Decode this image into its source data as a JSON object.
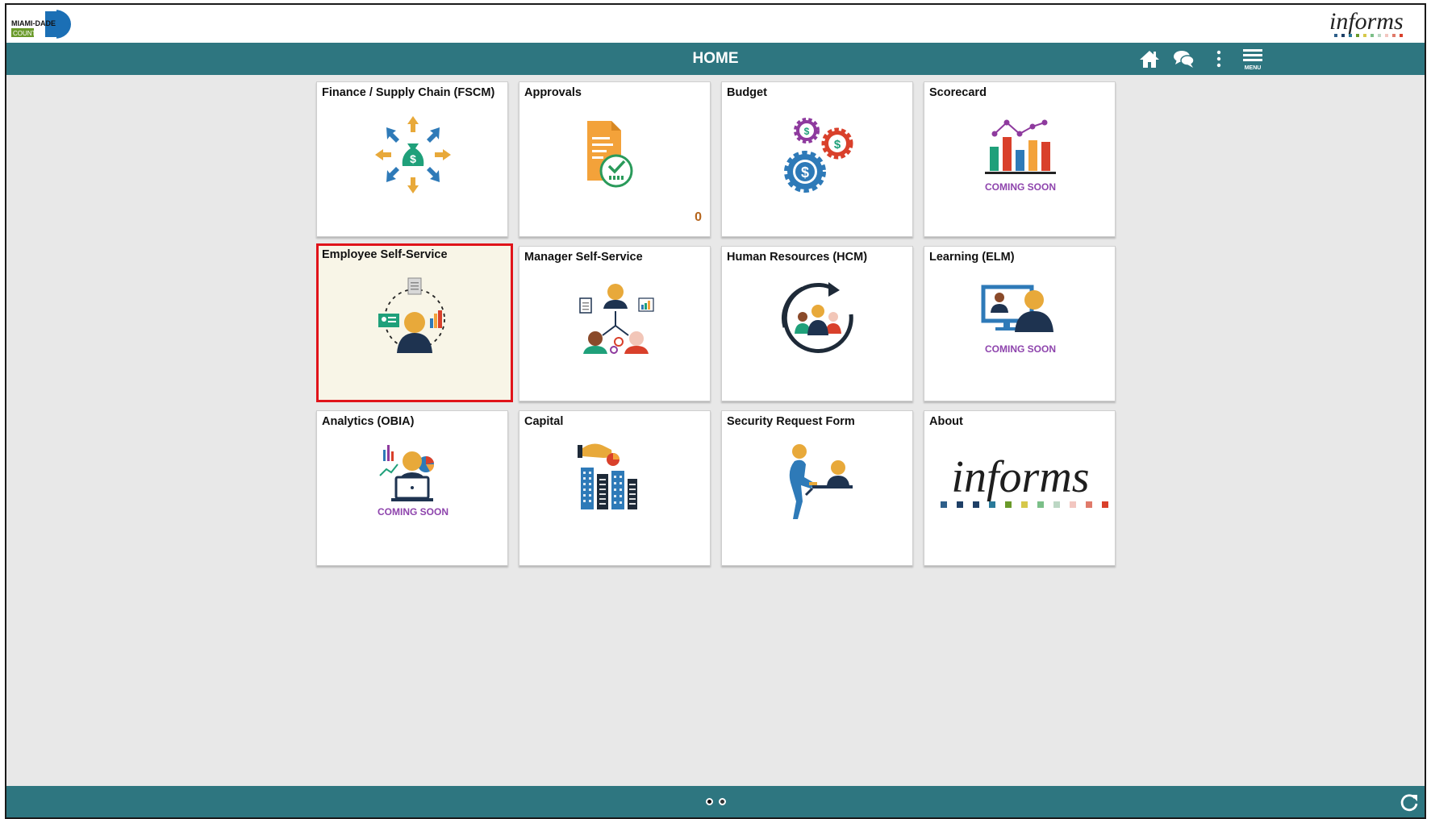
{
  "header": {
    "county_logo": "Miami-Dade County logo",
    "app_logo": "informs"
  },
  "navbar": {
    "title": "HOME",
    "icons": [
      "home-icon",
      "chat-icon",
      "more-options-icon",
      "menu-icon"
    ],
    "menu_label": "MENU"
  },
  "tiles": [
    {
      "title": "Finance / Supply Chain (FSCM)"
    },
    {
      "title": "Approvals",
      "count": "0"
    },
    {
      "title": "Budget"
    },
    {
      "title": "Scorecard",
      "badge": "COMING SOON"
    },
    {
      "title": "Employee Self-Service"
    },
    {
      "title": "Manager Self-Service"
    },
    {
      "title": "Human Resources (HCM)"
    },
    {
      "title": "Learning (ELM)",
      "badge": "COMING SOON"
    },
    {
      "title": "Analytics (OBIA)",
      "badge": "COMING SOON"
    },
    {
      "title": "Capital"
    },
    {
      "title": "Security Request Form"
    },
    {
      "title": "About",
      "logo_text": "informs"
    }
  ],
  "footer": {
    "pages": 2,
    "current_page": 1
  },
  "colors": {
    "nav_bg": "#2e7680",
    "selected_border": "#e0131a",
    "selected_bg": "#f8f5e7",
    "coming_soon": "#8e44ad"
  }
}
